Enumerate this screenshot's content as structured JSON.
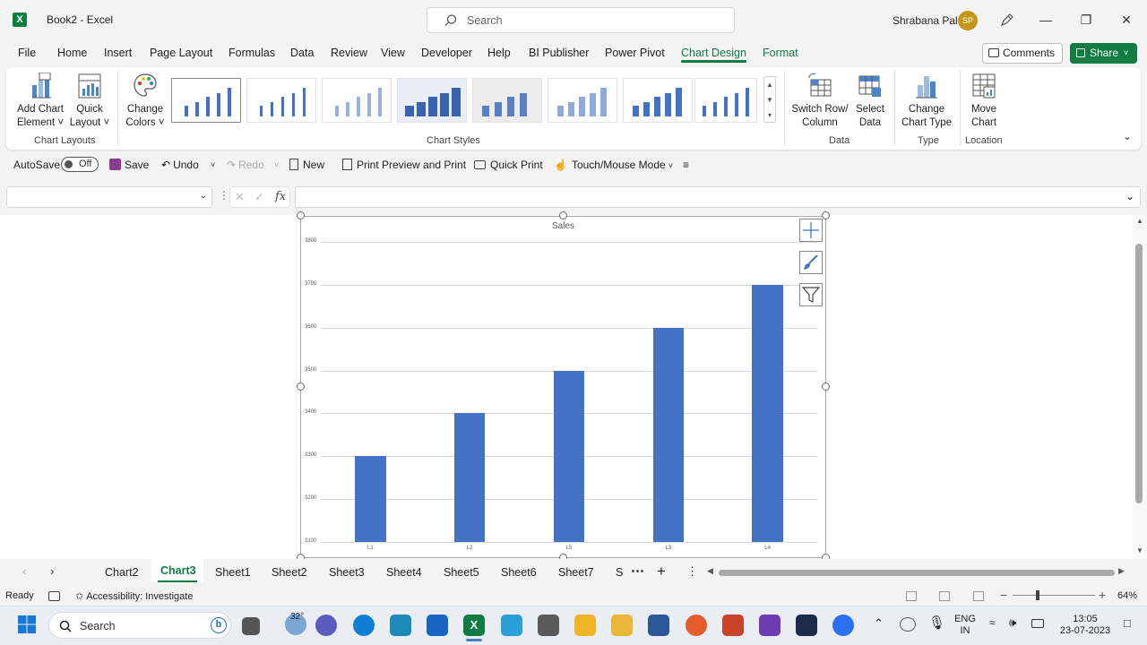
{
  "window": {
    "app_icon_letter": "X",
    "title": "Book2 - Excel",
    "search_placeholder": "Search",
    "user_name": "Shrabana Pal",
    "user_initials": "SP"
  },
  "menu": {
    "tabs": [
      "File",
      "Home",
      "Insert",
      "Page Layout",
      "Formulas",
      "Data",
      "Review",
      "View",
      "Developer",
      "Help",
      "BI Publisher",
      "Power Pivot",
      "Chart Design",
      "Format"
    ],
    "active": "Chart Design",
    "comments_label": "Comments",
    "share_label": "Share"
  },
  "ribbon": {
    "add_chart_element": [
      "Add Chart",
      "Element ˅"
    ],
    "quick_layout": [
      "Quick",
      "Layout ˅"
    ],
    "change_colors": [
      "Change",
      "Colors ˅"
    ],
    "group_chart_layouts": "Chart Layouts",
    "group_chart_styles": "Chart Styles",
    "switch_row_column": [
      "Switch Row/",
      "Column"
    ],
    "select_data": [
      "Select",
      "Data"
    ],
    "group_data": "Data",
    "change_chart_type": [
      "Change",
      "Chart Type"
    ],
    "group_type": "Type",
    "move_chart": [
      "Move",
      "Chart"
    ],
    "group_location": "Location"
  },
  "qat": {
    "autosave_label": "AutoSave",
    "autosave_state": "Off",
    "save_label": "Save",
    "undo_label": "Undo",
    "redo_label": "Redo",
    "new_label": "New",
    "print_preview_label": "Print Preview and Print",
    "quick_print_label": "Quick Print",
    "touch_mode_label": "Touch/Mouse Mode"
  },
  "formula_bar": {
    "fx_label": "fx",
    "name_box_value": "",
    "formula_value": ""
  },
  "chart_data": {
    "type": "bar",
    "title": "Sales",
    "categories": [
      "L1",
      "L2",
      "L5",
      "L3",
      "L4"
    ],
    "values": [
      3300,
      3400,
      3500,
      3600,
      3700
    ],
    "ylim": [
      3100,
      3800
    ],
    "yticks": [
      3800,
      3700,
      3600,
      3500,
      3400,
      3300,
      3200,
      3100
    ],
    "xlabel": "",
    "ylabel": "",
    "grid": true,
    "bar_color": "#4472c4"
  },
  "sheet_tabs": {
    "tabs": [
      "Chart2",
      "Chart3",
      "Sheet1",
      "Sheet2",
      "Sheet3",
      "Sheet4",
      "Sheet5",
      "Sheet6",
      "Sheet7",
      "S"
    ],
    "active": "Chart3"
  },
  "status": {
    "ready": "Ready",
    "accessibility": "Accessibility: Investigate",
    "zoom": "64%"
  },
  "taskbar": {
    "search_placeholder": "Search",
    "weather": "32°",
    "lang_line1": "ENG",
    "lang_line2": "IN",
    "time": "13:05",
    "date": "23-07-2023"
  },
  "colors": {
    "excel_green": "#107c41",
    "bar_blue": "#4472c4"
  }
}
